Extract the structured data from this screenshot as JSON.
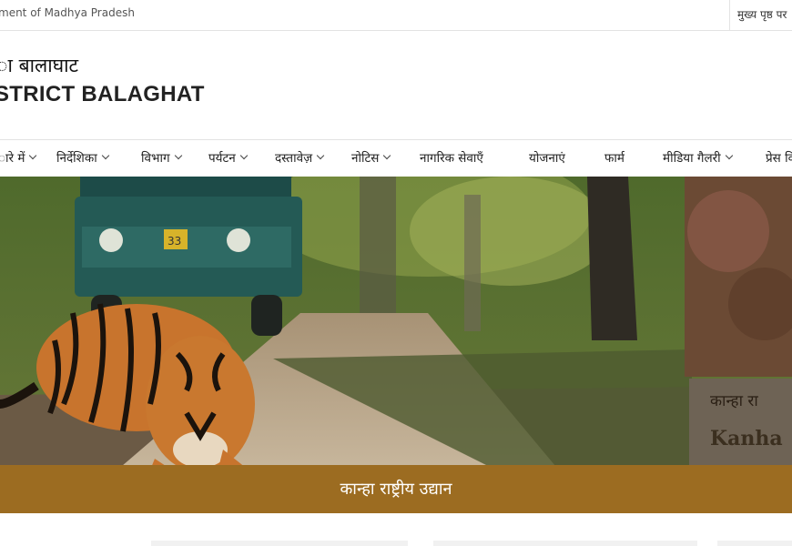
{
  "topbar": {
    "government_text": "ment of Madhya Pradesh",
    "main_page_link": "मुख्य पृष्ठ पर"
  },
  "brand": {
    "hindi_title": "ा बालाघाट",
    "english_title": "STRICT BALAGHAT"
  },
  "nav": {
    "items": [
      {
        "label": "ारे में",
        "has_dropdown": true
      },
      {
        "label": "निर्देशिका",
        "has_dropdown": true
      },
      {
        "label": "विभाग",
        "has_dropdown": true
      },
      {
        "label": "पर्यटन",
        "has_dropdown": true
      },
      {
        "label": "दस्तावेज़",
        "has_dropdown": true
      },
      {
        "label": "नोटिस",
        "has_dropdown": true
      },
      {
        "label": "नागरिक सेवाएँ",
        "has_dropdown": false
      },
      {
        "label": "योजनाएं",
        "has_dropdown": false
      },
      {
        "label": "फार्म",
        "has_dropdown": false
      },
      {
        "label": "मीडिया गैलरी",
        "has_dropdown": true
      },
      {
        "label": "प्रेस वि",
        "has_dropdown": false
      }
    ]
  },
  "hero": {
    "caption": "कान्हा राष्ट्रीय उद्यान",
    "jeep_plate": "33",
    "sign_text_hindi": "कान्हा रा",
    "sign_text_english": "Kanha"
  },
  "colors": {
    "caption_bar": "#9c6c21",
    "border": "#e3e3e3"
  }
}
